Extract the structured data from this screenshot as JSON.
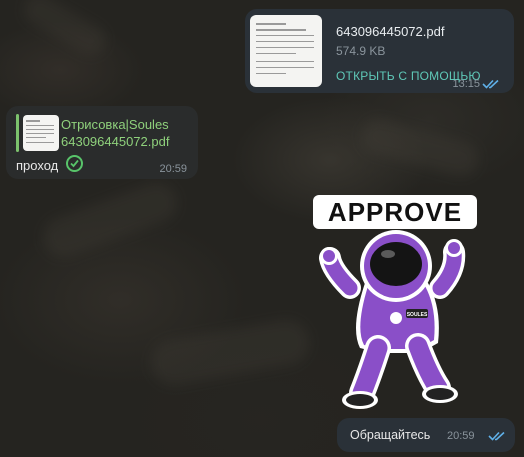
{
  "messages": {
    "document": {
      "file_name": "643096445072.pdf",
      "file_size": "574.9 KB",
      "open_with": "ОТКРЫТЬ С ПОМОЩЬЮ",
      "time": "13:15"
    },
    "reply": {
      "quoted_sender": "Отрисовка|Soules",
      "quoted_file": "643096445072.pdf",
      "text": "проход",
      "time": "20:59"
    },
    "sticker": {
      "caption": "APPROVE",
      "patch_text": "SOULES"
    },
    "last": {
      "text": "Обращайтесь",
      "time": "20:59"
    }
  },
  "colors": {
    "accent_green": "#8fd17c",
    "open_link": "#5fc9b8",
    "check_blue": "#5fb0e8",
    "sticker_purple": "#8a4fc8"
  }
}
